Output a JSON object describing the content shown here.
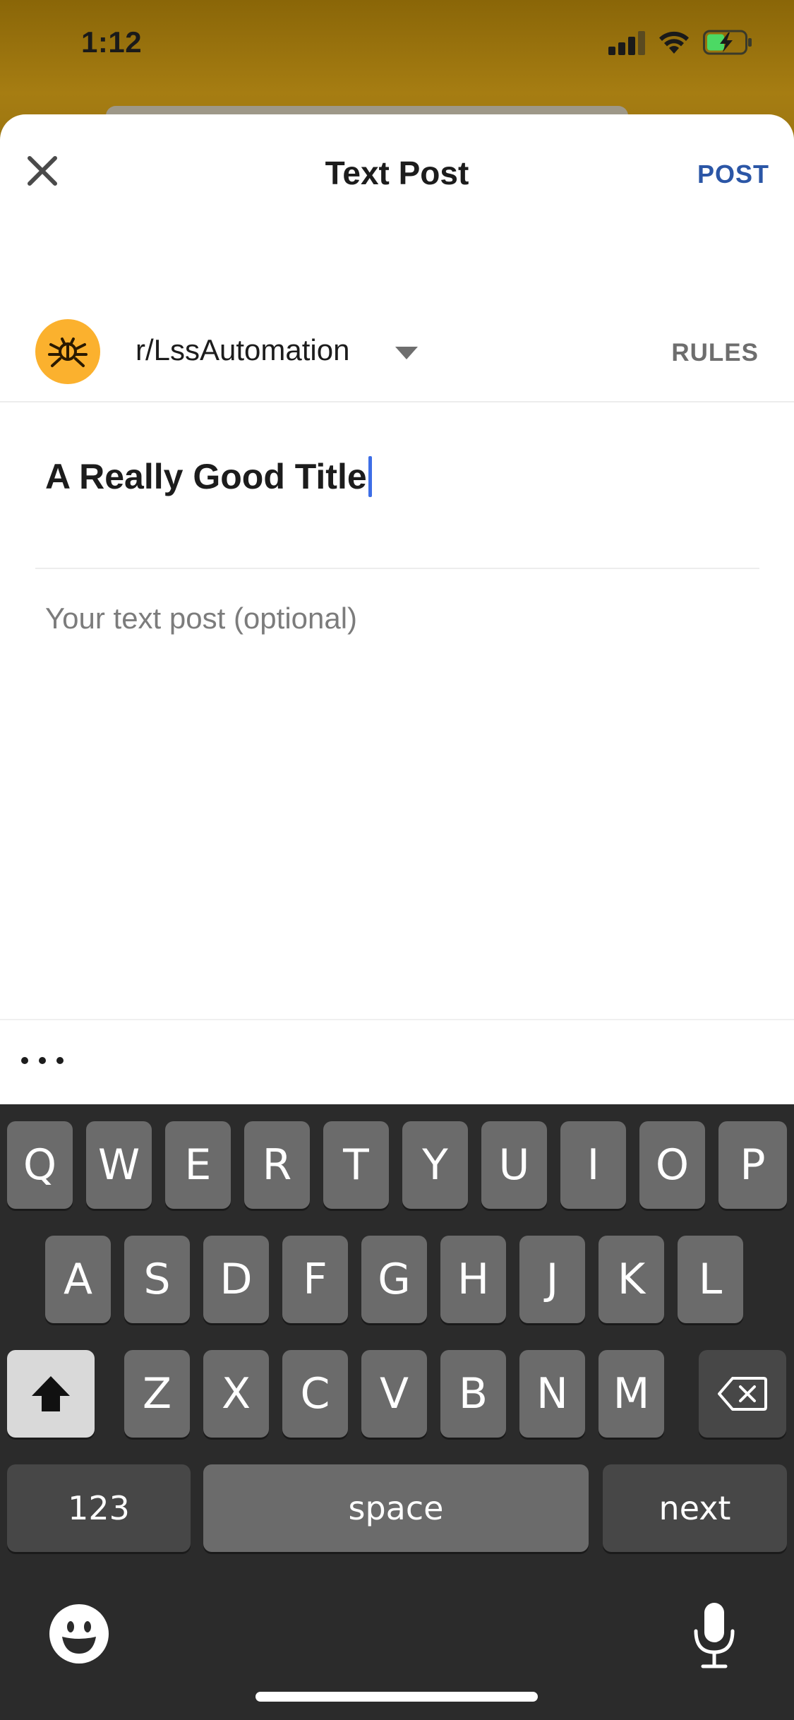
{
  "status_bar": {
    "time": "1:12",
    "colors": {
      "battery_charge": "#4cd964",
      "background": "#a67d12"
    }
  },
  "header": {
    "title": "Text Post",
    "post_label": "POST",
    "close_icon": "close-icon",
    "accent_color": "#2b56a6"
  },
  "community": {
    "name": "r/LssAutomation",
    "rules_label": "RULES",
    "avatar_color": "#fbb12e",
    "avatar_icon": "bug-icon"
  },
  "title_input": {
    "value": "A Really Good Title"
  },
  "body_input": {
    "placeholder": "Your text post (optional)"
  },
  "toolbar": {
    "more_icon": "more-dots-icon"
  },
  "keyboard": {
    "row1": [
      "Q",
      "W",
      "E",
      "R",
      "T",
      "Y",
      "U",
      "I",
      "O",
      "P"
    ],
    "row2": [
      "A",
      "S",
      "D",
      "F",
      "G",
      "H",
      "J",
      "K",
      "L"
    ],
    "row3": [
      "Z",
      "X",
      "C",
      "V",
      "B",
      "N",
      "M"
    ],
    "numbers_label": "123",
    "space_label": "space",
    "next_label": "next",
    "shift_icon": "shift-icon",
    "delete_icon": "backspace-icon",
    "emoji_icon": "emoji-icon",
    "mic_icon": "microphone-icon"
  }
}
